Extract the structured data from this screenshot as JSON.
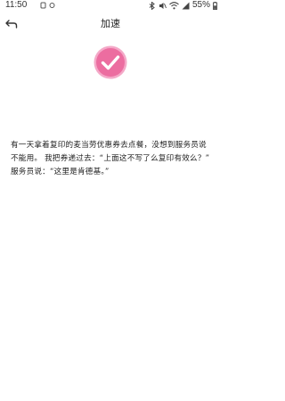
{
  "status_bar": {
    "time": "11:50",
    "battery": "55%"
  },
  "header": {
    "title": "加速",
    "back_icon": "back-arrow-icon"
  },
  "badge": {
    "icon": "checkmark-icon",
    "color": "#ec6da0"
  },
  "content": {
    "message": "有一天拿着复印的麦当劳优惠券去点餐，没想到服务员说不能用。 我把券递过去：“上面这不写了么复印有效么？” 服务员说：“这里是肯德基。”"
  }
}
